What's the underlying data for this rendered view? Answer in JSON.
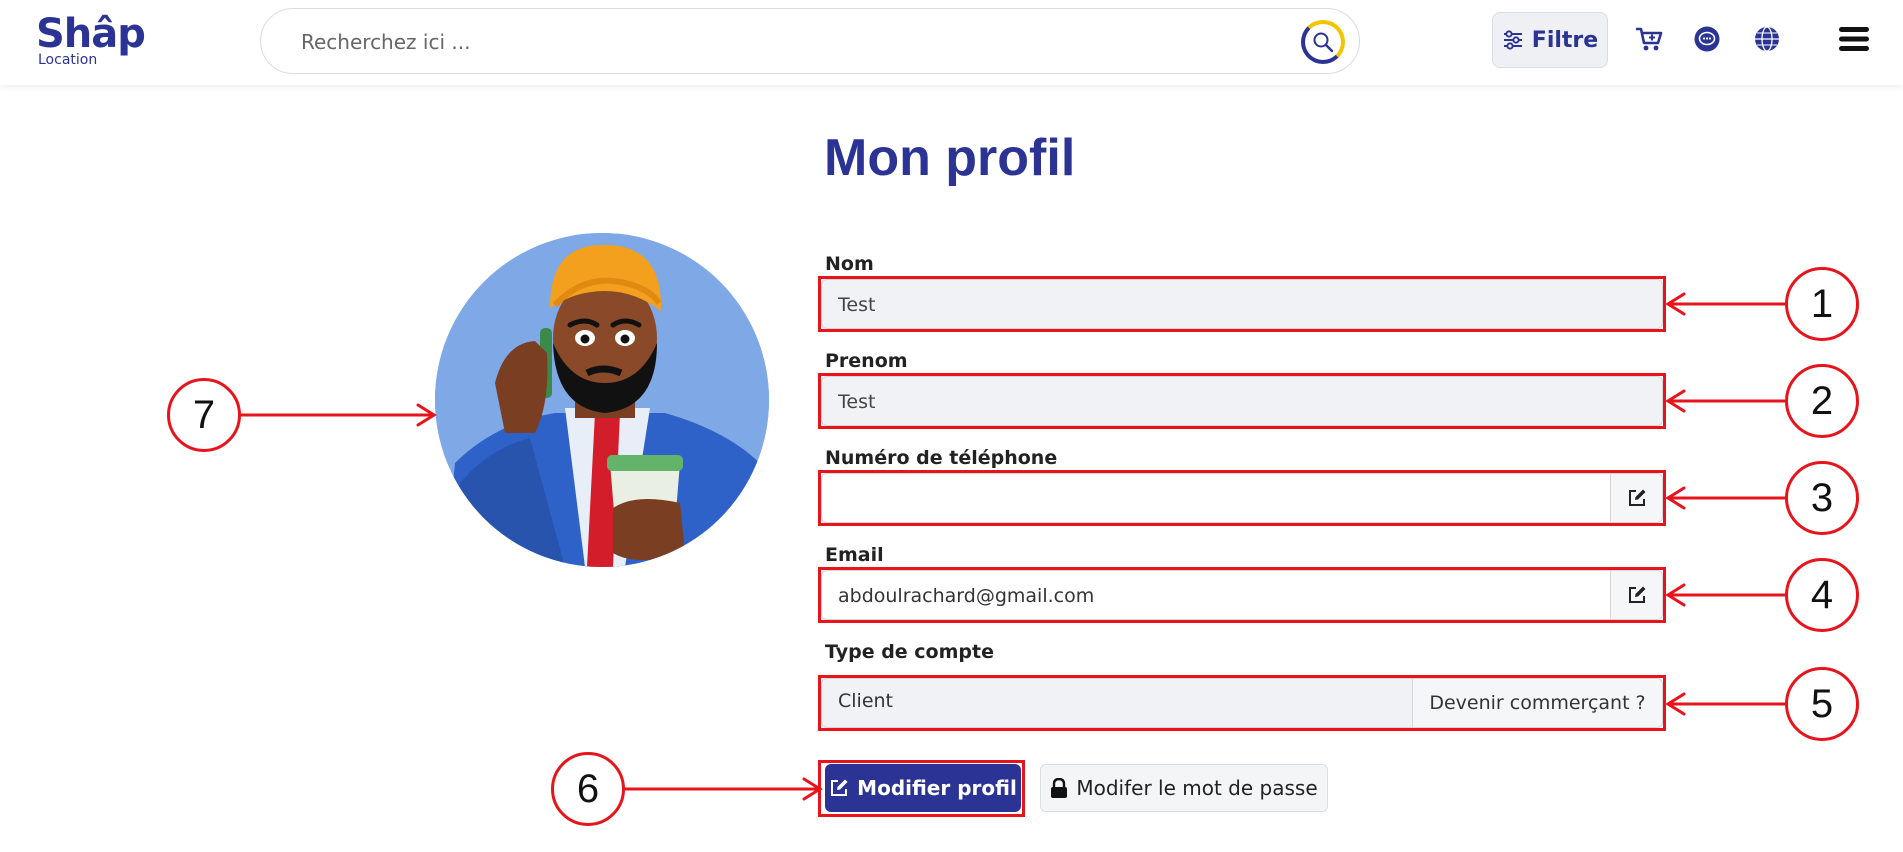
{
  "header": {
    "logo_main": "Shâp",
    "logo_sub": "Location",
    "search_placeholder": "Recherchez ici ...",
    "filter_label": "Filtre",
    "icons": [
      "cart-icon",
      "chat-icon",
      "globe-icon",
      "menu-icon"
    ]
  },
  "page": {
    "title": "Mon profil"
  },
  "form": {
    "nom_label": "Nom",
    "nom_value": "Test",
    "prenom_label": "Prenom",
    "prenom_value": "Test",
    "phone_label": "Numéro de téléphone",
    "phone_value": "",
    "email_label": "Email",
    "email_value": "abdoulrachard@gmail.com",
    "account_type_label": "Type de compte",
    "account_type_value": "Client",
    "become_merchant_label": "Devenir commerçant ?"
  },
  "actions": {
    "edit_profile_label": "Modifier profil",
    "change_password_label": "Modifer le mot de passe"
  },
  "annotations": [
    "1",
    "2",
    "3",
    "4",
    "5",
    "6",
    "7"
  ],
  "colors": {
    "brand": "#2b3494",
    "accent_yellow": "#f2c500",
    "annotation_red": "#e8141b"
  }
}
